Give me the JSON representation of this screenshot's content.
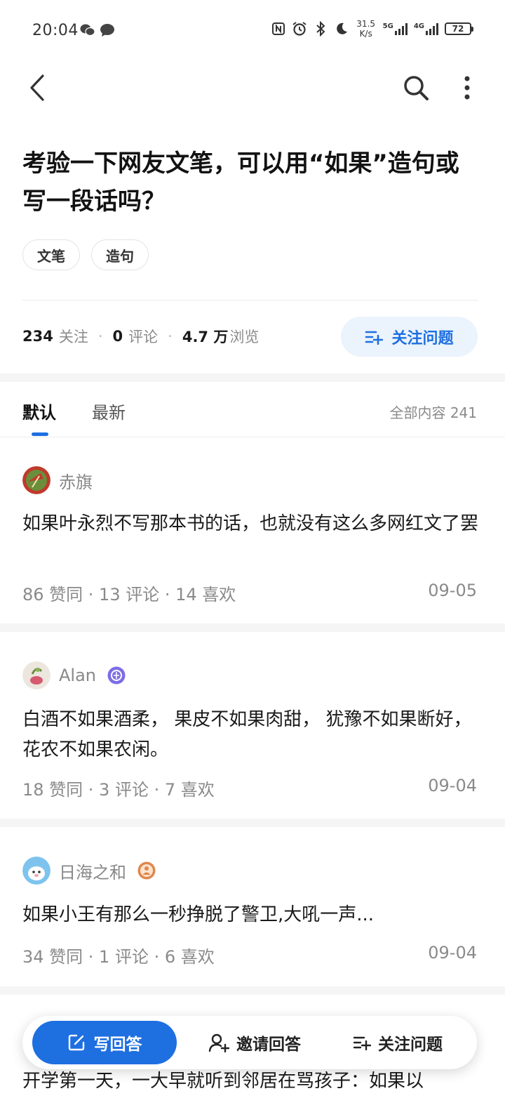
{
  "status_bar": {
    "time": "20:04",
    "net_speed_value": "31.5",
    "net_speed_unit": "K/s",
    "signal_1": "5G",
    "signal_2": "4G",
    "battery": "72"
  },
  "question": {
    "title": "考验一下网友文笔，可以用“如果”造句或写一段话吗？",
    "tags": [
      "文笔",
      "造句"
    ],
    "stats": {
      "followers": "234",
      "followers_label": "关注",
      "comments": "0",
      "comments_label": "评论",
      "views": "4.7 万",
      "views_label": "浏览"
    },
    "follow_button": "关注问题"
  },
  "tabs": {
    "default": "默认",
    "newest": "最新",
    "count_label": "全部内容 241"
  },
  "answers": [
    {
      "author": "赤旗",
      "text": "如果叶永烈不写那本书的话，也就没有这么多网红文了罢",
      "meta": "86  赞同 · 13  评论 · 14  喜欢",
      "date": "09-05"
    },
    {
      "author": "Alan",
      "text": "白酒不如果酒柔， 果皮不如果肉甜， 犹豫不如果断好， 花农不如果农闲。",
      "meta": "18  赞同 · 3  评论 · 7  喜欢",
      "date": "09-04"
    },
    {
      "author": "日海之和",
      "text": "如果小王有那么一秒挣脱了警卫,大吼一声...",
      "meta": "34  赞同 · 1  评论 · 6  喜欢",
      "date": "09-04"
    }
  ],
  "partial_answer_text": "开学第一天，一大早就听到邻居在骂孩子：如果以",
  "bottom_bar": {
    "write": "写回答",
    "invite": "邀请回答",
    "follow": "关注问题"
  },
  "colors": {
    "accent": "#1e6fe0",
    "accent_light": "#ebf3fd",
    "muted_text": "#8a8a8a",
    "separator": "#f5f5f5"
  }
}
